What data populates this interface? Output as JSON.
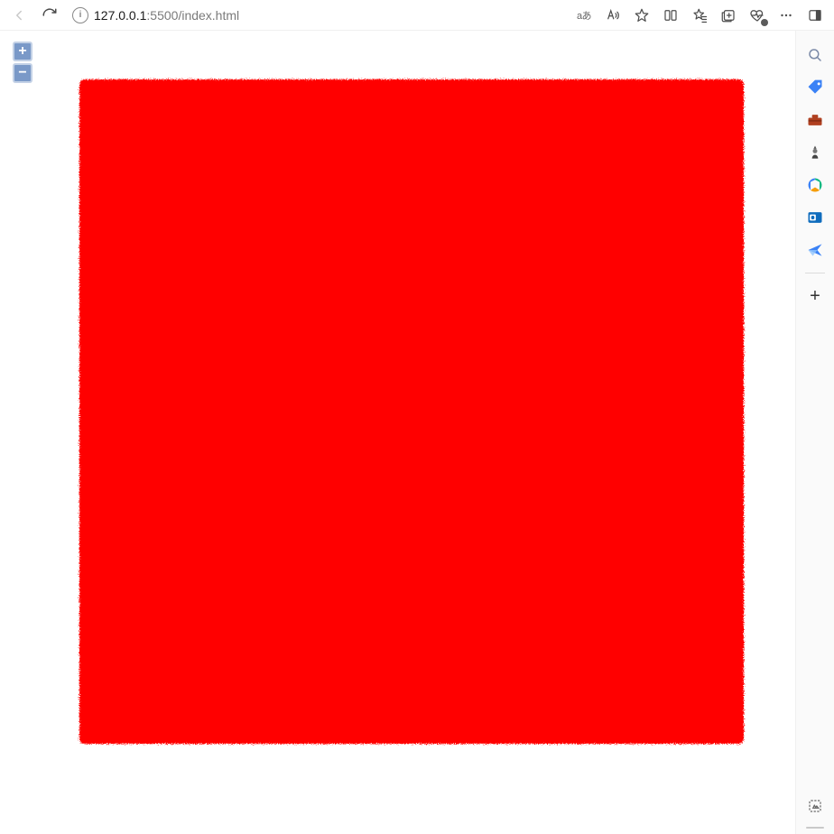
{
  "browser": {
    "address": {
      "info_label": "i",
      "host": "127.0.0.1",
      "port": ":5500",
      "path": "/index.html"
    },
    "translate_label": "aあ",
    "sidebar_plus": "+"
  },
  "map": {
    "zoom_in": "+",
    "zoom_out": "−",
    "feature_color": "#ff0000"
  }
}
